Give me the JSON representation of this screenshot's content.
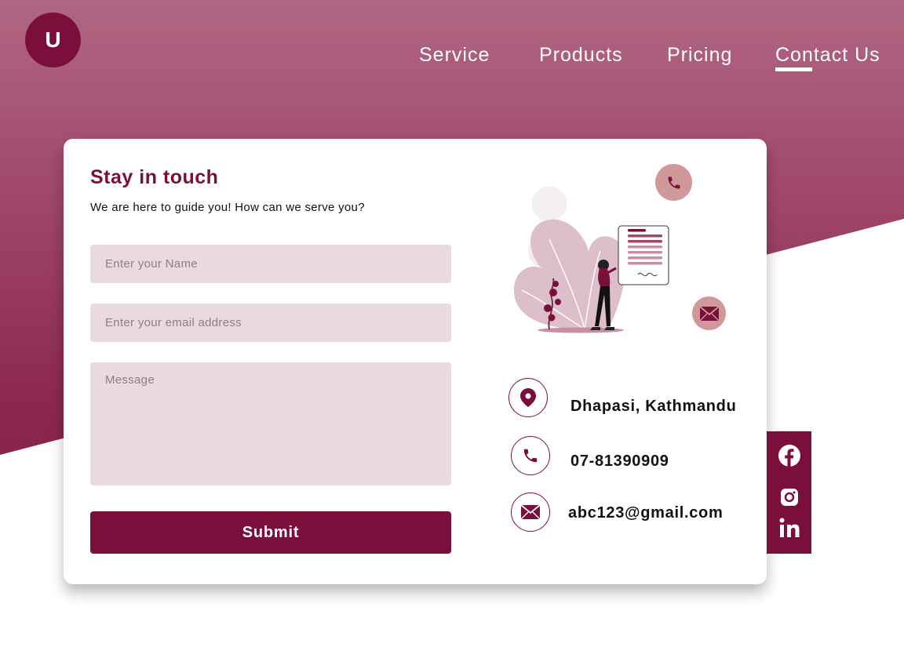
{
  "logo": {
    "letter": "U"
  },
  "nav": {
    "service": "Service",
    "products": "Products",
    "pricing": "Pricing",
    "contact": "Contact Us",
    "active": "Contact Us"
  },
  "form": {
    "title": "Stay in touch",
    "subtitle": "We are here to guide you! How can we serve you?",
    "name_placeholder": "Enter your Name",
    "email_placeholder": "Enter your email address",
    "message_placeholder": "Message",
    "submit_label": "Submit"
  },
  "contact": {
    "address": "Dhapasi, Kathmandu",
    "phone": "07-81390909",
    "email": "abc123@gmail.com"
  },
  "social": [
    "facebook-icon",
    "instagram-icon",
    "linkedin-icon"
  ],
  "colors": {
    "brand": "#7b0f3b",
    "field_bg": "#eadadf",
    "accent_light": "#d09898"
  }
}
